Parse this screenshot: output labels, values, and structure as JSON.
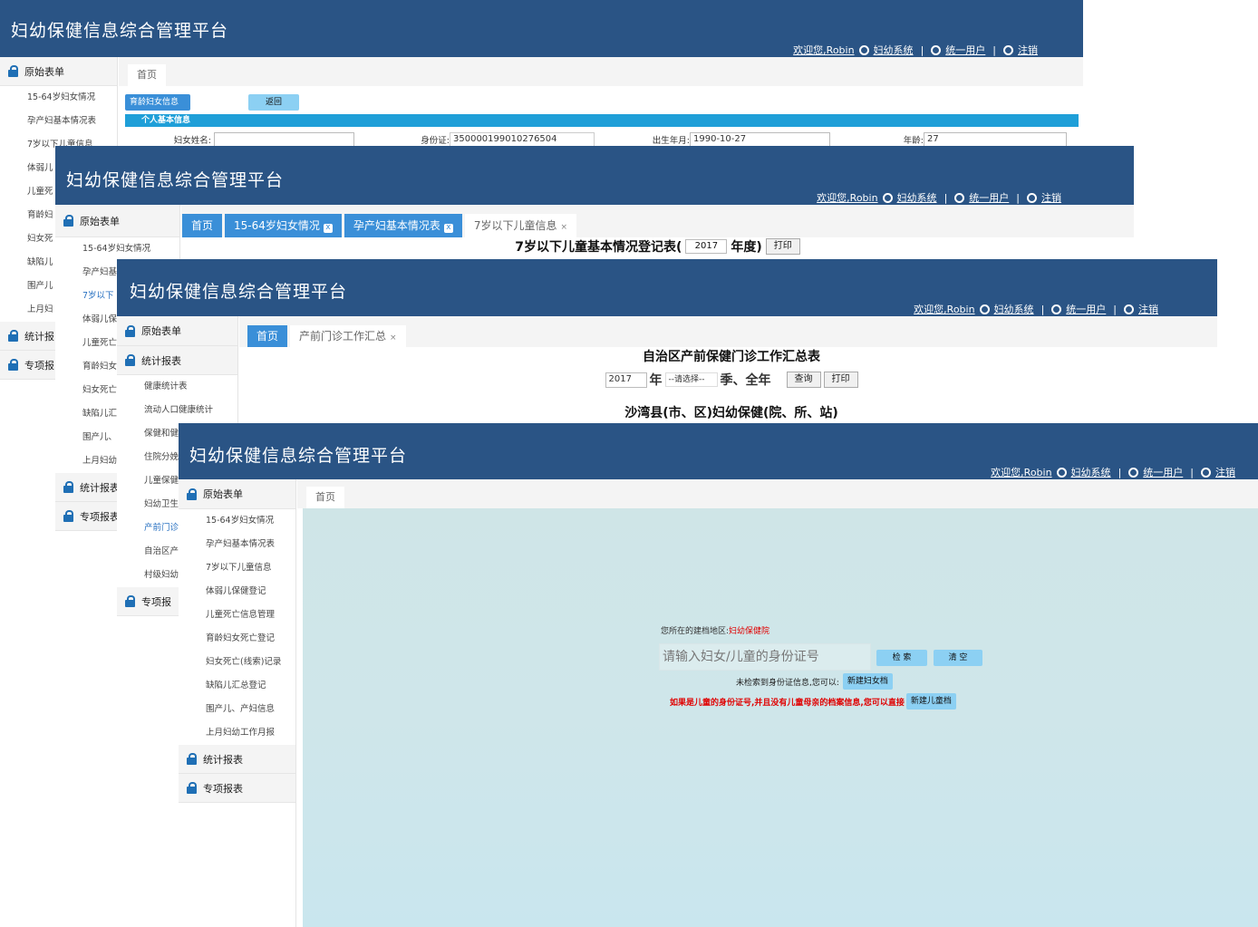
{
  "app_title": "妇幼保健信息综合管理平台",
  "user_bar": {
    "welcome": "欢迎您,Robin",
    "system": "妇幼系统",
    "unified": "统一用户",
    "logout": "注销",
    "sep": "|"
  },
  "w1": {
    "side": {
      "group": "原始表单",
      "items": [
        "15-64岁妇女情况",
        "孕产妇基本情况表",
        "7岁以下儿童信息",
        "体弱儿",
        "儿童死",
        "育龄妇",
        "妇女死",
        "缺陷儿",
        "围产儿",
        "上月妇"
      ],
      "groups2": [
        "统计报",
        "专项报"
      ]
    },
    "tab_home": "首页",
    "form_tab": "育龄妇女信息",
    "back_btn": "返回",
    "section_bar": "个人基本信息",
    "fields": {
      "name_label": "妇女姓名:",
      "name_value": "",
      "id_label": "身份证:",
      "id_value": "350000199010276504",
      "dob_label": "出生年月:",
      "dob_value": "1990-10-27",
      "age_label": "年龄:",
      "age_value": "27"
    }
  },
  "w2": {
    "side": {
      "group": "原始表单",
      "items": [
        "15-64岁妇女情况",
        "孕产妇基",
        "7岁以下",
        "体弱儿保",
        "儿童死亡",
        "育龄妇女",
        "妇女死亡",
        "缺陷儿汇",
        "围产儿、",
        "上月妇幼"
      ],
      "groups2": [
        "统计报表",
        "专项报表"
      ]
    },
    "tabs": [
      "首页",
      "15-64岁妇女情况",
      "孕产妇基本情况表",
      "7岁以下儿童信息"
    ],
    "report_title_pre": "7岁以下儿童基本情况登记表(",
    "year": "2017",
    "report_title_post": "年度)",
    "print_btn": "打印"
  },
  "w3": {
    "side": {
      "groups": [
        "原始表单",
        "统计报表"
      ],
      "items": [
        "健康统计表",
        "流动人口健康统计",
        "保健和健",
        "住院分娩",
        "儿童保健",
        "妇幼卫生",
        "产前门诊",
        "自治区产",
        "村级妇幼"
      ],
      "group3": "专项报"
    },
    "tabs": [
      "首页",
      "产前门诊工作汇总"
    ],
    "title": "自治区产前保健门诊工作汇总表",
    "year": "2017",
    "year_unit": "年",
    "quarter_placeholder": "--请选择--",
    "quarter_unit": "季、全年",
    "query_btn": "查询",
    "print_btn": "打印",
    "subtitle": "沙湾县(市、区)妇幼保健(院、所、站)"
  },
  "w4": {
    "side": {
      "group": "原始表单",
      "items": [
        "15-64岁妇女情况",
        "孕产妇基本情况表",
        "7岁以下儿童信息",
        "体弱儿保健登记",
        "儿童死亡信息管理",
        "育龄妇女死亡登记",
        "妇女死亡(线索)记录",
        "缺陷儿汇总登记",
        "围产儿、产妇信息",
        "上月妇幼工作月报"
      ],
      "groups2": [
        "统计报表",
        "专项报表"
      ]
    },
    "tab_home": "首页",
    "area_label": "您所在的建档地区:",
    "area_value": "妇幼保健院",
    "search_placeholder": "请输入妇女/儿童的身份证号",
    "search_btn": "检 索",
    "clear_btn": "清 空",
    "not_found_text": "未检索到身份证信息,您可以:",
    "new_woman_btn": "新建妇女档",
    "child_hint": "如果是儿童的身份证号,并且没有儿童母亲的档案信息,您可以直接",
    "new_child_btn": "新建儿童档"
  },
  "colors": {
    "header": "#2a5485",
    "tab_blue": "#3a8fd8",
    "light_btn": "#8cd0f3",
    "warning": "#e00000"
  }
}
